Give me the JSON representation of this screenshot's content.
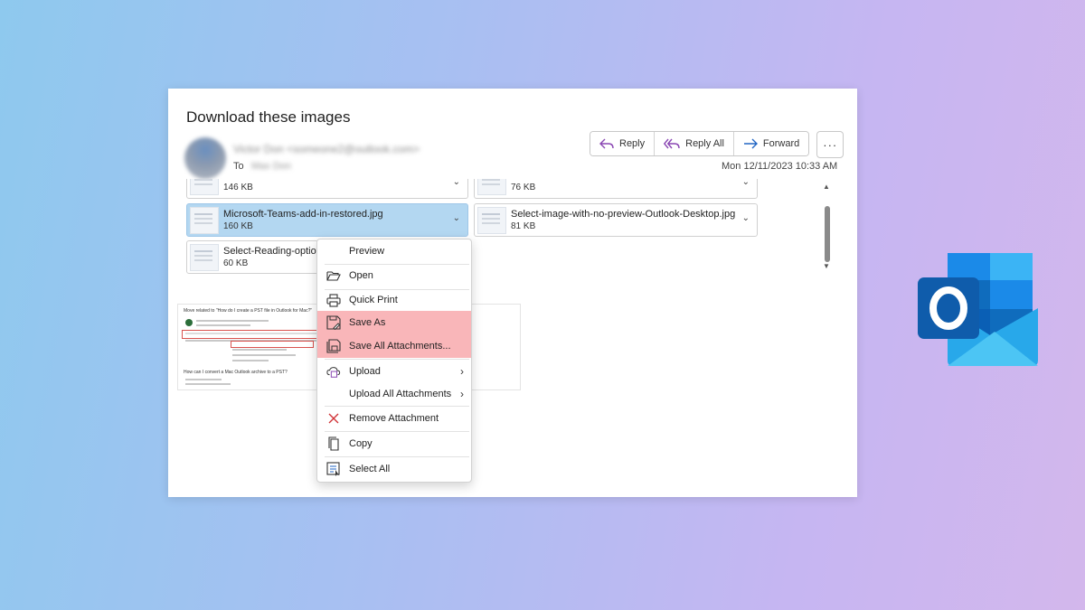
{
  "email": {
    "subject": "Download these images",
    "sender": "Victor Don <someone2@outlook.com>",
    "to_label": "To",
    "to_value": "Max Don",
    "date": "Mon 12/11/2023 10:33 AM"
  },
  "actions": {
    "reply": "Reply",
    "reply_all": "Reply All",
    "forward": "Forward",
    "more": "···"
  },
  "attachments": [
    {
      "name": "",
      "size": "146 KB"
    },
    {
      "name": "",
      "size": "76 KB"
    },
    {
      "name": "Microsoft-Teams-add-in-restored.jpg",
      "size": "160 KB"
    },
    {
      "name": "Select-image-with-no-preview-Outlook-Desktop.jpg",
      "size": "81 KB"
    },
    {
      "name": "Select-Reading-option",
      "size": "60 KB"
    }
  ],
  "preview": {
    "title": "Move related to \"How do I create a PST file in Outlook for Mac?\"",
    "footer": "How can I convert a Mac Outlook archive to a PST?"
  },
  "context_menu": {
    "items": [
      {
        "label": "Preview",
        "icon": "none"
      },
      {
        "label": "Open",
        "icon": "folder-open-icon"
      },
      {
        "label": "Quick Print",
        "icon": "printer-icon"
      },
      {
        "label": "Save As",
        "icon": "save-icon"
      },
      {
        "label": "Save All Attachments...",
        "icon": "save-all-icon"
      },
      {
        "label": "Upload",
        "icon": "cloud-upload-icon"
      },
      {
        "label": "Upload All Attachments",
        "icon": "none"
      },
      {
        "label": "Remove Attachment",
        "icon": "close-icon"
      },
      {
        "label": "Copy",
        "icon": "copy-icon"
      },
      {
        "label": "Select All",
        "icon": "select-all-icon"
      }
    ],
    "highlight_color": "#f9b6b9"
  },
  "colors": {
    "selected_attachment": "#b3d7f1",
    "outlook_blue": "#0f6cbd",
    "reply_icon": "#8a47b3",
    "forward_icon": "#2266c4",
    "remove_icon": "#d13438"
  }
}
